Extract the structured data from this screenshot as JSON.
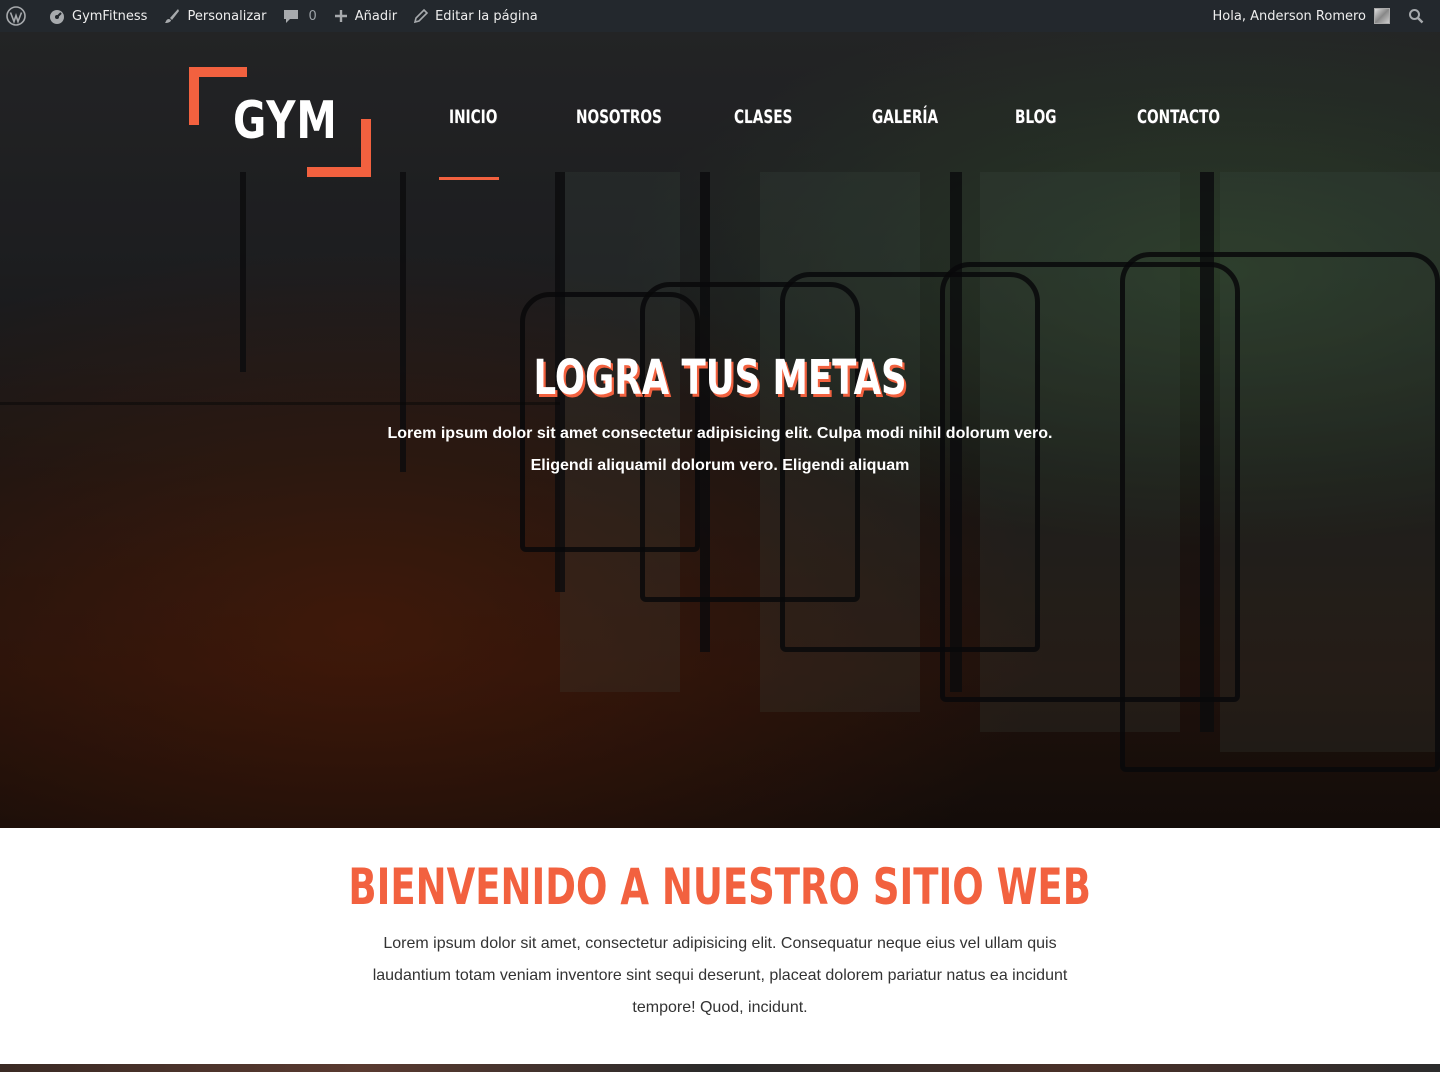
{
  "adminbar": {
    "site_name": "GymFitness",
    "customize": "Personalizar",
    "comments_count": "0",
    "add_new": "Añadir",
    "edit_page": "Editar la página",
    "greeting": "Hola, Anderson Romero"
  },
  "header": {
    "logo_text": "GYM",
    "nav": [
      {
        "label": "Inicio",
        "active": true
      },
      {
        "label": "Nosotros"
      },
      {
        "label": "Clases"
      },
      {
        "label": "Galería"
      },
      {
        "label": "Blog"
      },
      {
        "label": "Contacto"
      }
    ]
  },
  "hero": {
    "title": "Logra tus metas",
    "text": "Lorem ipsum dolor sit amet consectetur adipisicing elit. Culpa modi nihil dolorum vero. Eligendi aliquamil dolorum vero. Eligendi aliquam"
  },
  "welcome": {
    "title": "Bienvenido a nuestro sitio web",
    "text": "Lorem ipsum dolor sit amet, consectetur adipisicing elit. Consequatur neque eius vel ullam quis laudantium totam veniam inventore sint sequi deserunt, placeat dolorem pariatur natus ea incidunt tempore! Quod, incidunt."
  },
  "colors": {
    "accent": "#f2613f",
    "adminbar_bg": "#23282d"
  },
  "icons": {
    "wp": "wordpress-logo-icon",
    "site": "dashboard-icon",
    "customize": "paintbrush-icon",
    "comments": "comment-bubble-icon",
    "add": "plus-icon",
    "edit": "pencil-icon",
    "search": "search-icon"
  }
}
